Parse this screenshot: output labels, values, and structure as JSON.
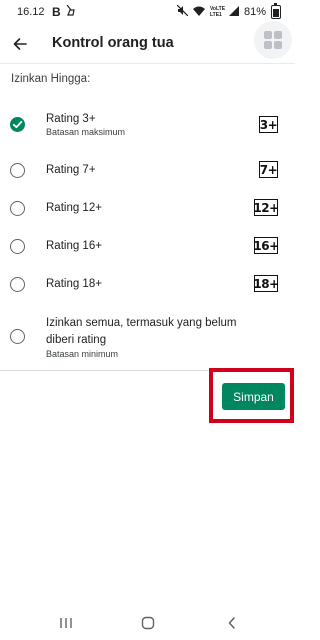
{
  "status_bar": {
    "time": "16.12",
    "bold_letter": "B",
    "battery": "81%",
    "network": "VoLTE LTE1"
  },
  "app_bar": {
    "title": "Kontrol orang tua",
    "back_icon": "arrow-back-icon",
    "apps_icon": "grid-apps-icon"
  },
  "section_label": "Izinkan Hingga:",
  "options": [
    {
      "title": "Rating 3+",
      "subtitle": "Batasan maksimum",
      "badge": "3+",
      "checked": true
    },
    {
      "title": "Rating 7+",
      "subtitle": "",
      "badge": "7+",
      "checked": false
    },
    {
      "title": "Rating 12+",
      "subtitle": "",
      "badge": "12+",
      "checked": false
    },
    {
      "title": "Rating 16+",
      "subtitle": "",
      "badge": "16+",
      "checked": false
    },
    {
      "title": "Rating 18+",
      "subtitle": "",
      "badge": "18+",
      "checked": false
    },
    {
      "title": "Izinkan semua, termasuk yang belum",
      "title_line2": "diberi rating",
      "subtitle": "Batasan minimum",
      "badge": "",
      "checked": false
    }
  ],
  "save_button": {
    "label": "Simpan"
  },
  "colors": {
    "accent": "#01875f",
    "highlight": "#d0021b"
  },
  "nav_bar": {
    "recents_icon": "recents-icon",
    "home_icon": "home-icon",
    "back_icon": "nav-back-icon"
  }
}
